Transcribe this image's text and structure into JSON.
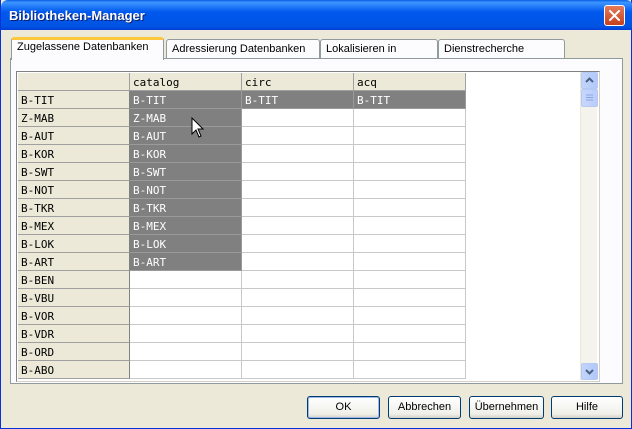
{
  "window": {
    "title": "Bibliotheken-Manager",
    "close_icon": "close-icon"
  },
  "tabs": [
    {
      "label": "Zugelassene Datenbanken",
      "active": true
    },
    {
      "label": "Adressierung Datenbanken",
      "active": false
    },
    {
      "label": "Lokalisieren in",
      "active": false
    },
    {
      "label": "Dienstrecherche",
      "active": false
    }
  ],
  "grid": {
    "columns": [
      "catalog",
      "circ",
      "acq"
    ],
    "rows": [
      {
        "header": "B-TIT",
        "cells": [
          "B-TIT",
          "B-TIT",
          "B-TIT"
        ]
      },
      {
        "header": "Z-MAB",
        "cells": [
          "Z-MAB",
          "",
          ""
        ]
      },
      {
        "header": "B-AUT",
        "cells": [
          "B-AUT",
          "",
          ""
        ]
      },
      {
        "header": "B-KOR",
        "cells": [
          "B-KOR",
          "",
          ""
        ]
      },
      {
        "header": "B-SWT",
        "cells": [
          "B-SWT",
          "",
          ""
        ]
      },
      {
        "header": "B-NOT",
        "cells": [
          "B-NOT",
          "",
          ""
        ]
      },
      {
        "header": "B-TKR",
        "cells": [
          "B-TKR",
          "",
          ""
        ]
      },
      {
        "header": "B-MEX",
        "cells": [
          "B-MEX",
          "",
          ""
        ]
      },
      {
        "header": "B-LOK",
        "cells": [
          "B-LOK",
          "",
          ""
        ]
      },
      {
        "header": "B-ART",
        "cells": [
          "B-ART",
          "",
          ""
        ]
      },
      {
        "header": "B-BEN",
        "cells": [
          "",
          "",
          ""
        ]
      },
      {
        "header": "B-VBU",
        "cells": [
          "",
          "",
          ""
        ]
      },
      {
        "header": "B-VOR",
        "cells": [
          "",
          "",
          ""
        ]
      },
      {
        "header": "B-VDR",
        "cells": [
          "",
          "",
          ""
        ]
      },
      {
        "header": "B-ORD",
        "cells": [
          "",
          "",
          ""
        ]
      },
      {
        "header": "B-ABO",
        "cells": [
          "",
          "",
          ""
        ]
      }
    ]
  },
  "buttons": {
    "ok": "OK",
    "cancel": "Abbrechen",
    "apply": "Übernehmen",
    "help": "Hilfe"
  },
  "colors": {
    "selected_cell": "#808080",
    "title_bar": "#0054e3",
    "active_tab_accent": "#ffc83c"
  }
}
